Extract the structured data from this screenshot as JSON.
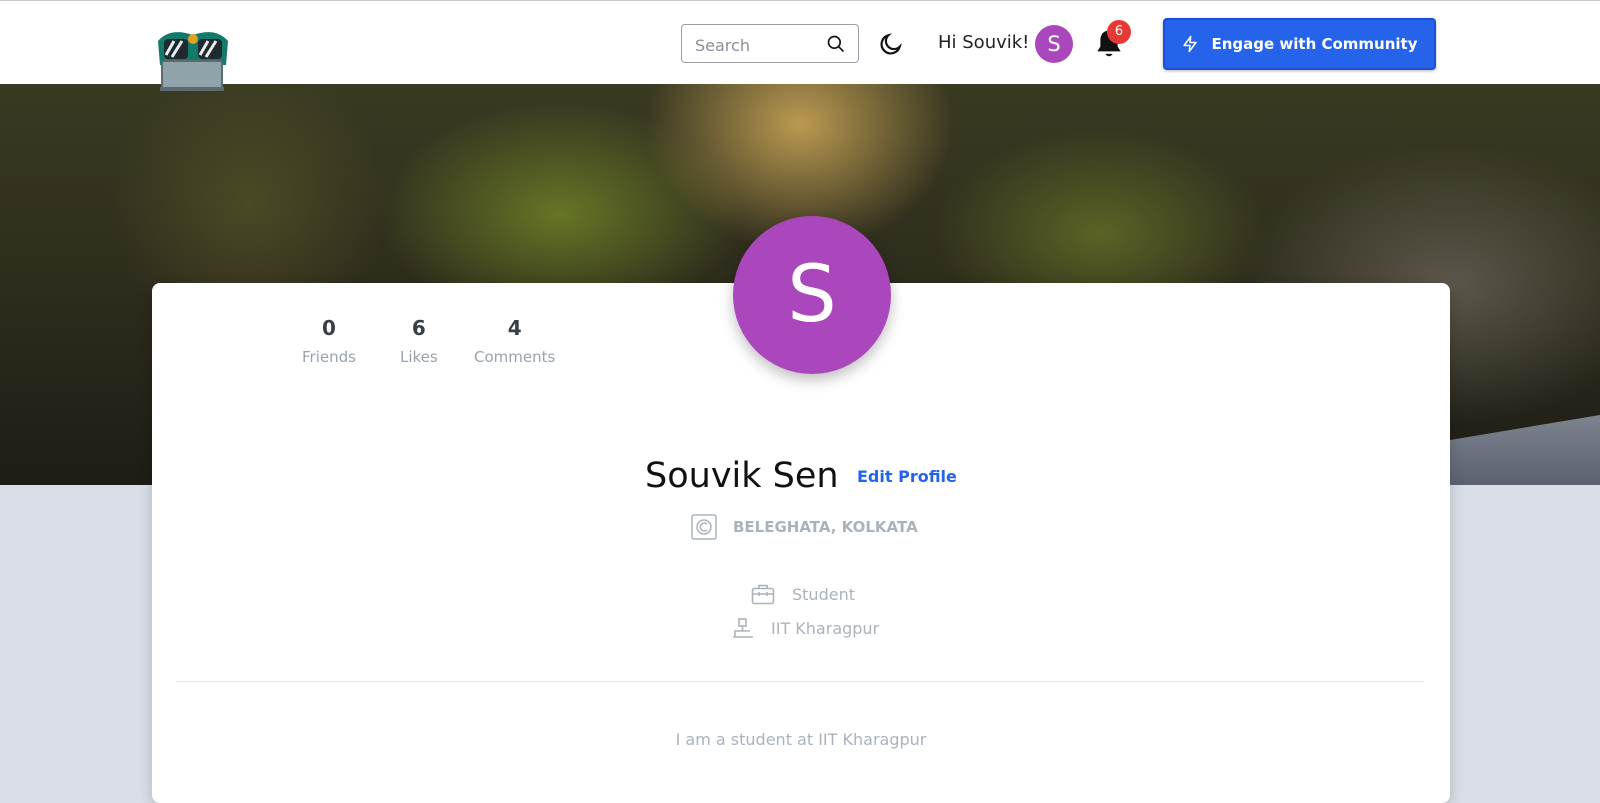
{
  "header": {
    "search_placeholder": "Search",
    "greeting": "Hi Souvik!",
    "avatar_initial": "S",
    "notification_count": "6",
    "engage_label": "Engage with Community"
  },
  "profile": {
    "avatar_initial": "S",
    "stats": [
      {
        "value": "0",
        "label": "Friends"
      },
      {
        "value": "6",
        "label": "Likes"
      },
      {
        "value": "4",
        "label": "Comments"
      }
    ],
    "name": "Souvik Sen",
    "edit_label": "Edit Profile",
    "location": "BELEGHATA, KOLKATA",
    "occupation": "Student",
    "institution": "IIT Kharagpur",
    "bio": "I am a student at IIT Kharagpur"
  },
  "colors": {
    "accent": "#2563eb",
    "avatar": "#ab47bc",
    "badge": "#e53935",
    "muted_text": "#aab3bd"
  },
  "icons": {
    "logo": "mascot-logo",
    "search": "search-icon",
    "theme": "moon-icon",
    "notifications": "bell-icon",
    "engage": "lightning-icon",
    "location": "location-icon",
    "occupation": "briefcase-icon",
    "institution": "school-icon"
  }
}
